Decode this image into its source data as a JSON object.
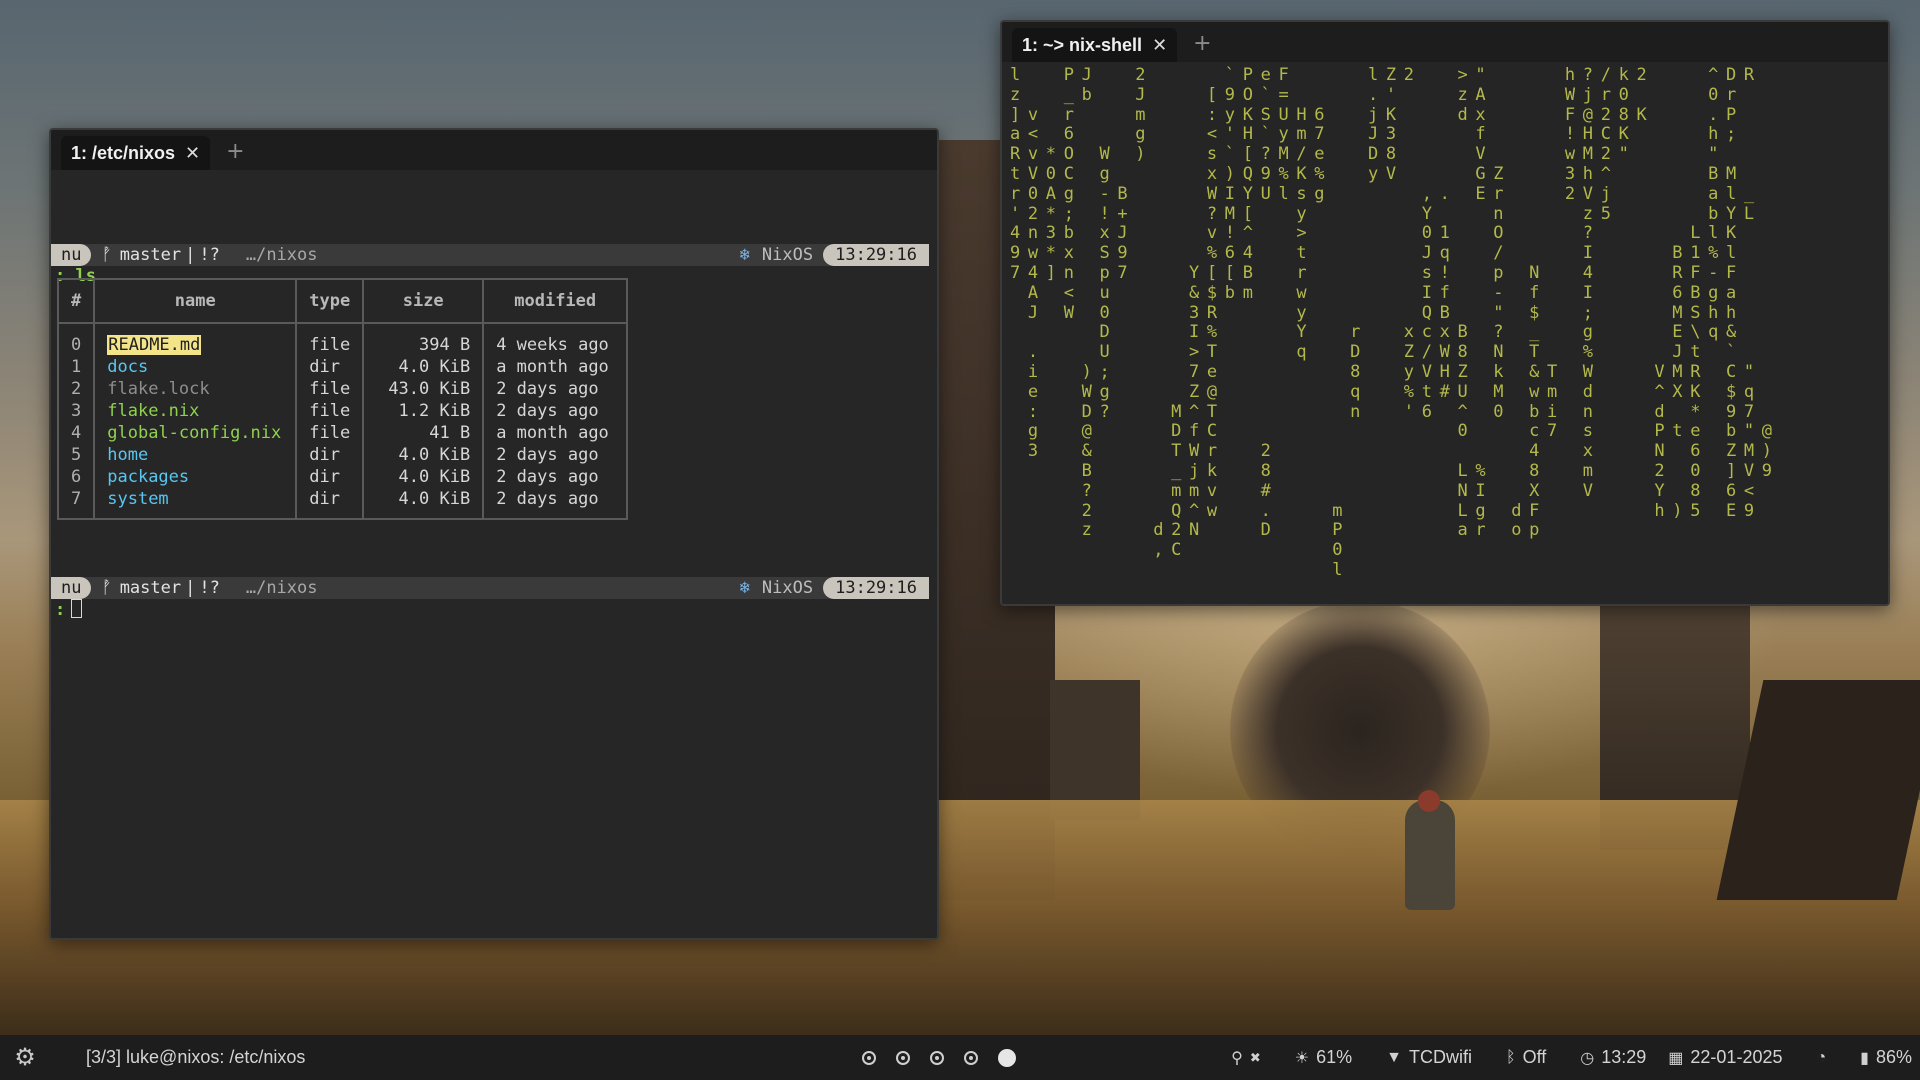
{
  "colors": {
    "terminal_bg": "#262626",
    "bar_bg": "#1d1d1d",
    "prompt_pill": "#c9c4bc",
    "dir_blue": "#59c6f2",
    "nix_green": "#8fd14f",
    "highlight_yellow": "#f3e48a",
    "rain_olive": "#b3b84a"
  },
  "left_window": {
    "tab_label": "1: /etc/nixos",
    "tab_close_icon": "close-icon",
    "tab_add": "+",
    "prompt1": {
      "shell": "nu",
      "git_icon": "git-branch-icon",
      "git_glyph": "ᚡ",
      "branch": "master",
      "sep": "|",
      "status": "!?",
      "path": "…/nixos",
      "os_icon": "snowflake-icon",
      "os_glyph": "❄",
      "os": "NixOS",
      "time": "13:29:16"
    },
    "command": "ls",
    "colon": ":",
    "table": {
      "headers": [
        "#",
        "name",
        "type",
        "size",
        "modified"
      ],
      "rows": [
        {
          "idx": "0",
          "name": "README.md",
          "type": "file",
          "size": "394 B",
          "modified": "4 weeks ago"
        },
        {
          "idx": "1",
          "name": "docs",
          "type": "dir",
          "size": "4.0 KiB",
          "modified": "a month ago"
        },
        {
          "idx": "2",
          "name": "flake.lock",
          "type": "file",
          "size": "43.0 KiB",
          "modified": "2 days ago"
        },
        {
          "idx": "3",
          "name": "flake.nix",
          "type": "file",
          "size": "1.2 KiB",
          "modified": "2 days ago"
        },
        {
          "idx": "4",
          "name": "global-config.nix",
          "type": "file",
          "size": "41 B",
          "modified": "a month ago"
        },
        {
          "idx": "5",
          "name": "home",
          "type": "dir",
          "size": "4.0 KiB",
          "modified": "2 days ago"
        },
        {
          "idx": "6",
          "name": "packages",
          "type": "dir",
          "size": "4.0 KiB",
          "modified": "2 days ago"
        },
        {
          "idx": "7",
          "name": "system",
          "type": "dir",
          "size": "4.0 KiB",
          "modified": "2 days ago"
        }
      ]
    },
    "prompt2": {
      "shell": "nu",
      "git_glyph": "ᚡ",
      "branch": "master",
      "sep": "|",
      "status": "!?",
      "path": "…/nixos",
      "os_glyph": "❄",
      "os": "NixOS",
      "time": "13:29:16"
    }
  },
  "right_window": {
    "tab_label": "1: ~> nix-shell",
    "tab_close_icon": "close-icon",
    "tab_add": "+",
    "rain_columns": [
      "l\nz\n]\na\nR\nt\nr\n'\n4\n9\n7",
      "\n\nv\n<\nv\nV\n0\n2\nn\nw\n4\nA\nJ\n\n.\ni\ne\n:\ng\n3",
      "\n\n\n\n*\n0\nA\n*\n3\n*\n]",
      "P\n_\nr\n6\nO\nC\ng\n;\nb\nx\nn\n<\nW",
      "J\nb\n\n\n\n\n\n\n\n\n\n\n\n\n\n)\nW\nD\n@\n&\nB\n?\n2\nz",
      "\n\n\n\nW\ng\n-\n!\nx\nS\np\nu\n0\nD\nU\n;\ng\n?",
      "\n\n\n\n\n\nB\n+\nJ\n9\n7",
      "2\nJ\nm\ng\n)",
      "\n\n\n\n\n\n\n\n\n\n\n\n\n\n\n\n\n\n\n\n\n\n\nd\n,",
      "\n\n\n\n\n\n\n\n\n\n\n\n\n\n\n\n\nM\nD\nT\n_\nm\nQ\n2\nC",
      "\n\n\n\n\n\n\n\n\n\nY\n&\n3\nI\n>\n7\nZ\n^\nf\nW\nj\nm\n^\nN",
      "\n[\n:\n<\ns\nx\nW\n?\nv\n%\n[\n$\nR\n%\nT\ne\n@\nT\nC\nr\nk\nv\nw",
      "`\n9\ny\n'\n`\n)\nI\nM\n!\n6\n[\nb",
      "P\nO\nK\nH\n[\nQ\nY\n[\n^\n4\nB\nm",
      "e\n`\nS\n`\n?\n9\nU\n\n\n\n\n\n\n\n\n\n\n\n\n2\n8\n#\n.\nD",
      "F\n=\nU\ny\nM\n%\nl",
      "\n\nH\nm\n/\nK\ns\ny\n>\nt\nr\nw\ny\nY\nq",
      "\n\n6\n7\ne\n%\ng",
      "\n\n\n\n\n\n\n\n\n\n\n\n\n\n\n\n\n\n\n\n\n\nm\nP\n0\nl",
      "\n\n\n\n\n\n\n\n\n\n\n\n\nr\nD\n8\nq\nn",
      "l\n.\nj\nJ\nD\ny",
      "Z\n'\nK\n3\n8\nV",
      "2\n\n\n\n\n\n\n\n\n\n\n\n\nx\nZ\ny\n%\n'",
      "\n\n\n\n\n\n,\nY\n0\nJ\ns\nI\nQ\nc\n/\nV\nt\n6",
      "\n\n\n\n\n\n.\n\n1\nq\n!\nf\nB\nx\nW\nH\n#",
      ">\nz\nd\n\n\n\n\n\n\n\n\n\n\nB\n8\nZ\nU\n^\n0\n\nL\nN\nL\na",
      "\"\nA\nx\nf\nV\nG\nE\n\n\n\n\n\n\n\n\n\n\n\n\n\n%\nI\ng\nr",
      "\n\n\n\n\nZ\nr\nn\nO\n/\np\n-\n\"\n?\nN\nk\nM\n0",
      "\n\n\n\n\n\n\n\n\n\n\n\n\n\n\n\n\n\n\n\n\n\nd\no",
      "\n\n\n\n\n\n\n\n\n\nN\nf\n$\n_\nT\n&\nw\nb\nc\n4\n8\nX\nF\np",
      "\n\n\n\n\n\n\n\n\n\n\n\n\n\n\nT\nm\ni\n7",
      "h\nW\nF\n!\nw\n3\n2",
      "?\nj\n@\nH\nM\nh\nV\nz\n?\nI\n4\nI\n;\ng\n%\nW\nd\nn\ns\nx\nm\nV",
      "/\nr\n2\nC\n2\n^\nj\n5",
      "k\n0\n8\nK\n\"",
      "2\n\nK",
      "\n\n\n\n\n\n\n\n\n\n\n\n\n\n\nV\n^\nd\nP\nN\n2\nY\nh",
      "\n\n\n\n\n\n\n\n\nB\nR\n6\nM\nE\nJ\nM\nX\n\nt\n\n\n\n)",
      "\n\n\n\n\n\n\n\nL\n1\nF\nB\nS\n\\\nt\nR\nK\n*\ne\n6\n0\n8\n5",
      "^\n0\n.\nh\n\"\nB\na\nb\nl\n%\n-\ng\nh\nq",
      "D\nr\nP\n;\n\nM\nl\nY\nK\nl\nF\na\nh\n&\n`\nC\n$\n9\nb\nZ\n]\n6\nE",
      "R\n\n\n\n\n\n_\nL\n\n\n\n\n\n\n\n\"\nq\n7\n\"\nM\nV\n<\n9",
      "\n\n\n\n\n\n\n\n\n\n\n\n\n\n\n\n\n\n@\n)\n9"
    ]
  },
  "statusbar": {
    "settings_icon": "gear-icon",
    "gear_glyph": "⚙",
    "window_title": "[3/3] luke@nixos: /etc/nixos",
    "workspaces": [
      false,
      false,
      false,
      false,
      true
    ],
    "modules": {
      "mic_glyph": "⚲",
      "mic_mute_glyph": "✖",
      "brightness_glyph": "☀",
      "brightness": "61%",
      "wifi_glyph": "▼",
      "wifi": "TCDwifi",
      "bluetooth_glyph": "ᛒ",
      "bluetooth": "Off",
      "clock_glyph": "◷",
      "time": "13:29",
      "calendar_glyph": "▦",
      "date": "22-01-2025",
      "cpu_glyph": "◔",
      "battery_glyph": "▮",
      "battery": "86%"
    }
  }
}
